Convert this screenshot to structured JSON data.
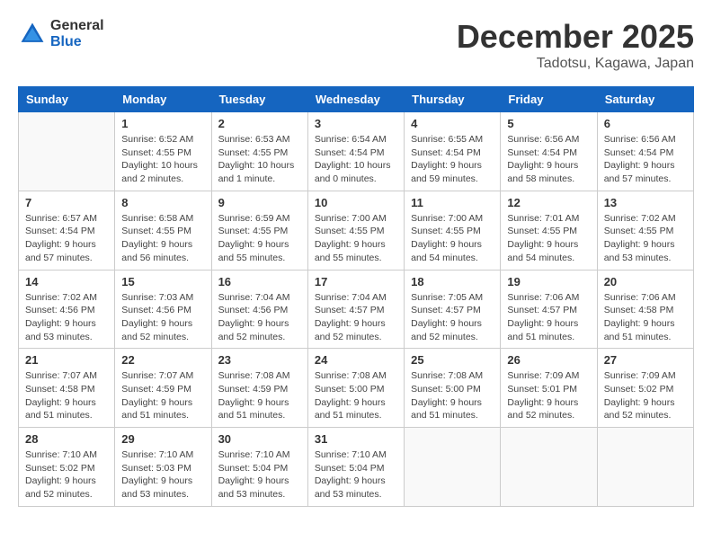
{
  "logo": {
    "general": "General",
    "blue": "Blue"
  },
  "header": {
    "title": "December 2025",
    "location": "Tadotsu, Kagawa, Japan"
  },
  "weekdays": [
    "Sunday",
    "Monday",
    "Tuesday",
    "Wednesday",
    "Thursday",
    "Friday",
    "Saturday"
  ],
  "weeks": [
    [
      {
        "day": "",
        "info": ""
      },
      {
        "day": "1",
        "info": "Sunrise: 6:52 AM\nSunset: 4:55 PM\nDaylight: 10 hours\nand 2 minutes."
      },
      {
        "day": "2",
        "info": "Sunrise: 6:53 AM\nSunset: 4:55 PM\nDaylight: 10 hours\nand 1 minute."
      },
      {
        "day": "3",
        "info": "Sunrise: 6:54 AM\nSunset: 4:54 PM\nDaylight: 10 hours\nand 0 minutes."
      },
      {
        "day": "4",
        "info": "Sunrise: 6:55 AM\nSunset: 4:54 PM\nDaylight: 9 hours\nand 59 minutes."
      },
      {
        "day": "5",
        "info": "Sunrise: 6:56 AM\nSunset: 4:54 PM\nDaylight: 9 hours\nand 58 minutes."
      },
      {
        "day": "6",
        "info": "Sunrise: 6:56 AM\nSunset: 4:54 PM\nDaylight: 9 hours\nand 57 minutes."
      }
    ],
    [
      {
        "day": "7",
        "info": "Sunrise: 6:57 AM\nSunset: 4:54 PM\nDaylight: 9 hours\nand 57 minutes."
      },
      {
        "day": "8",
        "info": "Sunrise: 6:58 AM\nSunset: 4:55 PM\nDaylight: 9 hours\nand 56 minutes."
      },
      {
        "day": "9",
        "info": "Sunrise: 6:59 AM\nSunset: 4:55 PM\nDaylight: 9 hours\nand 55 minutes."
      },
      {
        "day": "10",
        "info": "Sunrise: 7:00 AM\nSunset: 4:55 PM\nDaylight: 9 hours\nand 55 minutes."
      },
      {
        "day": "11",
        "info": "Sunrise: 7:00 AM\nSunset: 4:55 PM\nDaylight: 9 hours\nand 54 minutes."
      },
      {
        "day": "12",
        "info": "Sunrise: 7:01 AM\nSunset: 4:55 PM\nDaylight: 9 hours\nand 54 minutes."
      },
      {
        "day": "13",
        "info": "Sunrise: 7:02 AM\nSunset: 4:55 PM\nDaylight: 9 hours\nand 53 minutes."
      }
    ],
    [
      {
        "day": "14",
        "info": "Sunrise: 7:02 AM\nSunset: 4:56 PM\nDaylight: 9 hours\nand 53 minutes."
      },
      {
        "day": "15",
        "info": "Sunrise: 7:03 AM\nSunset: 4:56 PM\nDaylight: 9 hours\nand 52 minutes."
      },
      {
        "day": "16",
        "info": "Sunrise: 7:04 AM\nSunset: 4:56 PM\nDaylight: 9 hours\nand 52 minutes."
      },
      {
        "day": "17",
        "info": "Sunrise: 7:04 AM\nSunset: 4:57 PM\nDaylight: 9 hours\nand 52 minutes."
      },
      {
        "day": "18",
        "info": "Sunrise: 7:05 AM\nSunset: 4:57 PM\nDaylight: 9 hours\nand 52 minutes."
      },
      {
        "day": "19",
        "info": "Sunrise: 7:06 AM\nSunset: 4:57 PM\nDaylight: 9 hours\nand 51 minutes."
      },
      {
        "day": "20",
        "info": "Sunrise: 7:06 AM\nSunset: 4:58 PM\nDaylight: 9 hours\nand 51 minutes."
      }
    ],
    [
      {
        "day": "21",
        "info": "Sunrise: 7:07 AM\nSunset: 4:58 PM\nDaylight: 9 hours\nand 51 minutes."
      },
      {
        "day": "22",
        "info": "Sunrise: 7:07 AM\nSunset: 4:59 PM\nDaylight: 9 hours\nand 51 minutes."
      },
      {
        "day": "23",
        "info": "Sunrise: 7:08 AM\nSunset: 4:59 PM\nDaylight: 9 hours\nand 51 minutes."
      },
      {
        "day": "24",
        "info": "Sunrise: 7:08 AM\nSunset: 5:00 PM\nDaylight: 9 hours\nand 51 minutes."
      },
      {
        "day": "25",
        "info": "Sunrise: 7:08 AM\nSunset: 5:00 PM\nDaylight: 9 hours\nand 51 minutes."
      },
      {
        "day": "26",
        "info": "Sunrise: 7:09 AM\nSunset: 5:01 PM\nDaylight: 9 hours\nand 52 minutes."
      },
      {
        "day": "27",
        "info": "Sunrise: 7:09 AM\nSunset: 5:02 PM\nDaylight: 9 hours\nand 52 minutes."
      }
    ],
    [
      {
        "day": "28",
        "info": "Sunrise: 7:10 AM\nSunset: 5:02 PM\nDaylight: 9 hours\nand 52 minutes."
      },
      {
        "day": "29",
        "info": "Sunrise: 7:10 AM\nSunset: 5:03 PM\nDaylight: 9 hours\nand 53 minutes."
      },
      {
        "day": "30",
        "info": "Sunrise: 7:10 AM\nSunset: 5:04 PM\nDaylight: 9 hours\nand 53 minutes."
      },
      {
        "day": "31",
        "info": "Sunrise: 7:10 AM\nSunset: 5:04 PM\nDaylight: 9 hours\nand 53 minutes."
      },
      {
        "day": "",
        "info": ""
      },
      {
        "day": "",
        "info": ""
      },
      {
        "day": "",
        "info": ""
      }
    ]
  ]
}
